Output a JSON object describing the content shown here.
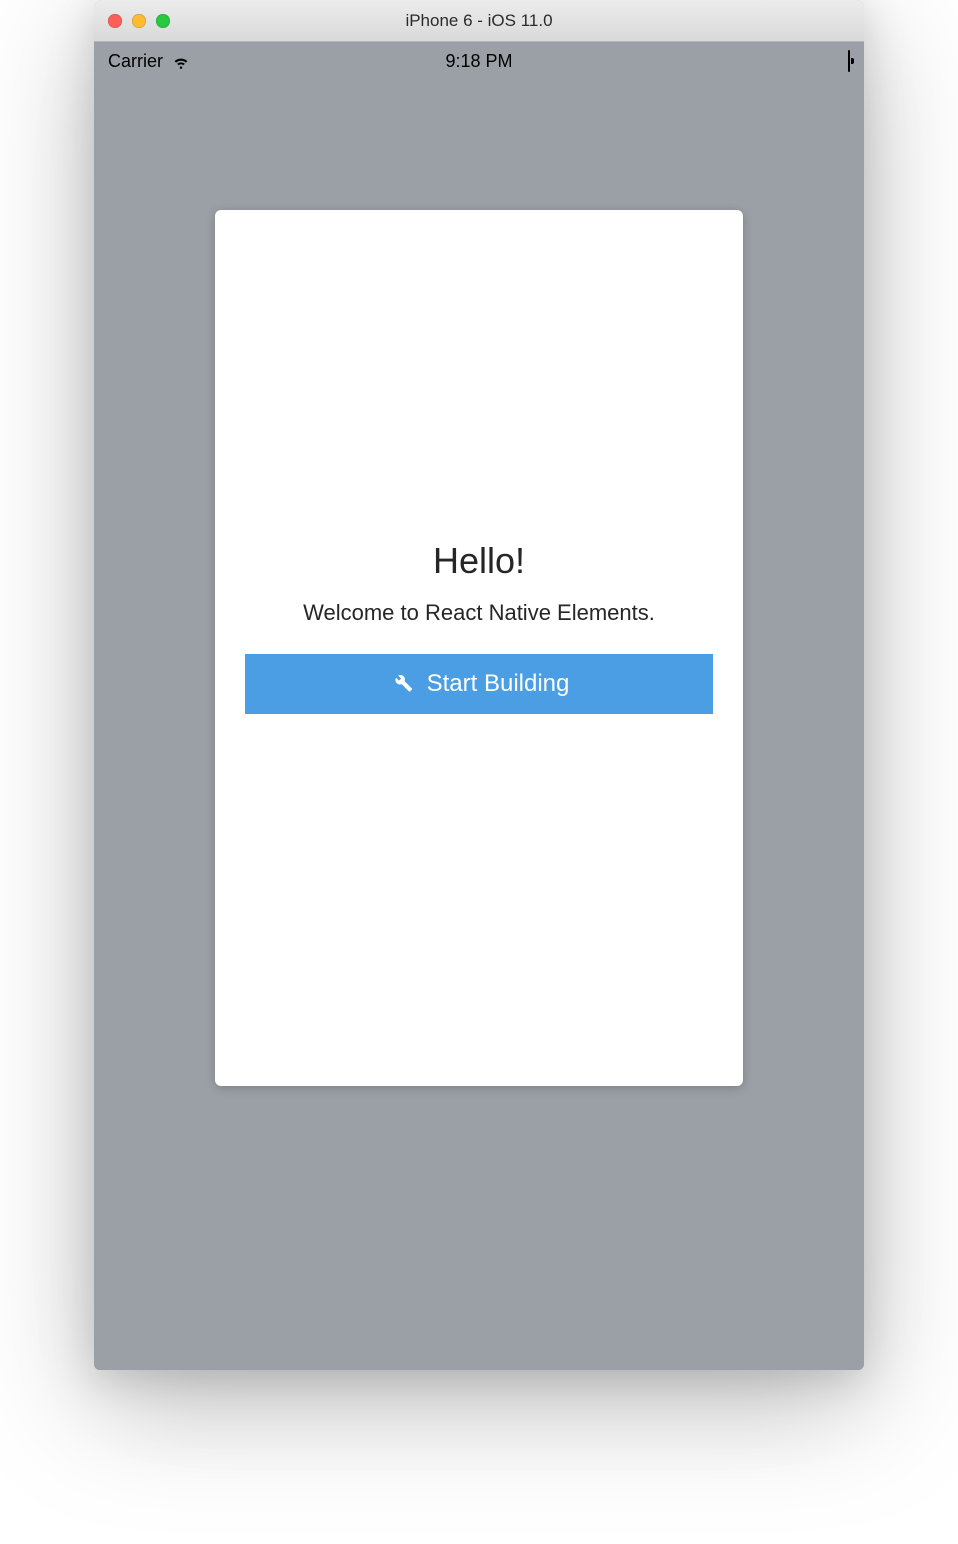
{
  "window": {
    "title": "iPhone 6 - iOS 11.0"
  },
  "statusbar": {
    "carrier": "Carrier",
    "time": "9:18 PM"
  },
  "card": {
    "title": "Hello!",
    "subtitle": "Welcome to React Native Elements.",
    "button_label": "Start Building"
  },
  "colors": {
    "accent": "#4b9ee3",
    "sim_background": "#9aa0a6"
  },
  "icons": {
    "wrench": "wrench-icon",
    "wifi": "wifi-icon",
    "battery": "battery-icon"
  }
}
